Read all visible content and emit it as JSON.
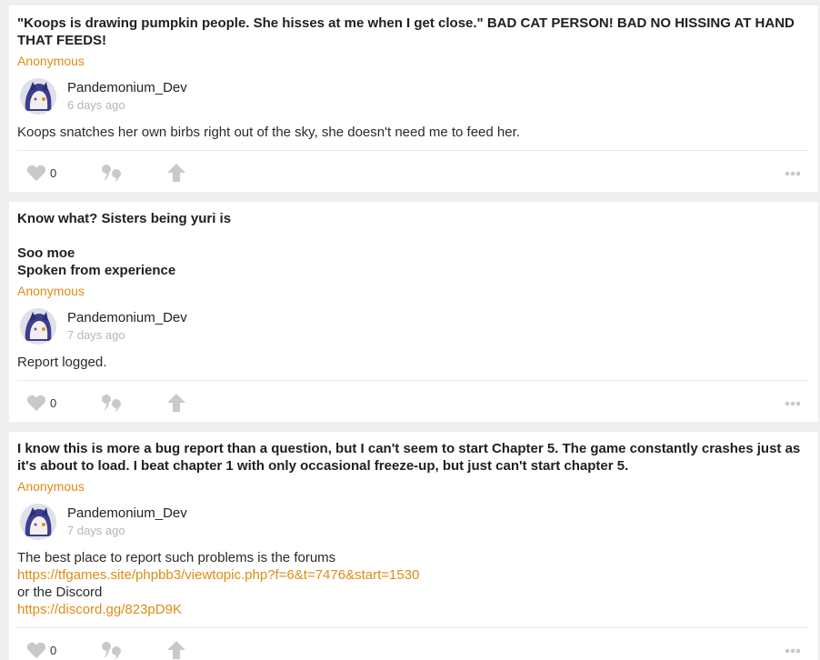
{
  "posts": [
    {
      "question": "\"Koops is drawing pumpkin people. She hisses at me when I get close.\" BAD CAT PERSON! BAD NO HISSING AT HAND THAT FEEDS!",
      "asker": "Anonymous",
      "author": "Pandemonium_Dev",
      "time": "6 days ago",
      "answer_lines": [
        "Koops snatches her own birbs right out of the sky, she doesn't need me to feed her."
      ],
      "likes": "0"
    },
    {
      "question": "Know what? Sisters being yuri is\n\nSoo moe\nSpoken from experience",
      "asker": "Anonymous",
      "author": "Pandemonium_Dev",
      "time": "7 days ago",
      "answer_lines": [
        "Report logged."
      ],
      "likes": "0"
    },
    {
      "question": "I know this is more a bug report than a question, but I can't seem to start Chapter 5. The game constantly crashes just as it's about to load. I beat chapter 1 with only occasional freeze-up, but just can't start chapter 5.",
      "asker": "Anonymous",
      "author": "Pandemonium_Dev",
      "time": "7 days ago",
      "answer_lines": [
        "The best place to report such problems is the forums",
        "https://tfgames.site/phpbb3/viewtopic.php?f=6&t=7476&start=1530",
        "or the Discord",
        "https://discord.gg/823pD9K"
      ],
      "likes": "0"
    }
  ],
  "icons": {
    "like": "heart-icon",
    "quote": "quote-icon",
    "share": "share-arrow-icon",
    "more": "more-dots-icon"
  },
  "colors": {
    "accent": "#e08a14",
    "icon_gray": "#c9c9c9",
    "background": "#efefef"
  }
}
